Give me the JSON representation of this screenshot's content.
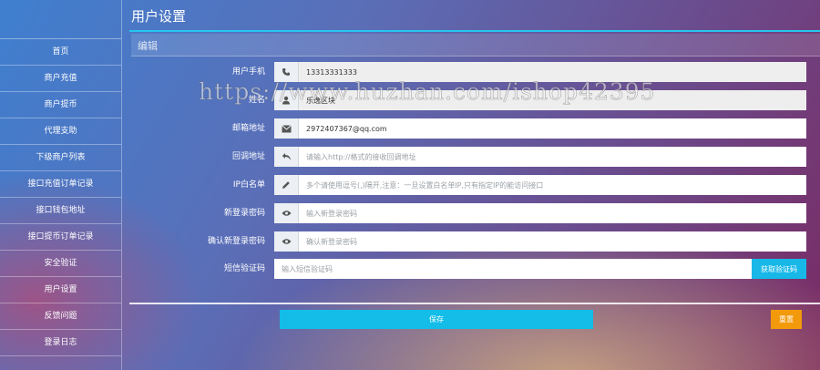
{
  "sidebar": {
    "items": [
      {
        "label": "首页"
      },
      {
        "label": "商户充值"
      },
      {
        "label": "商户提币"
      },
      {
        "label": "代理支助"
      },
      {
        "label": "下级商户列表"
      },
      {
        "label": "接口充值订单记录"
      },
      {
        "label": "接口钱包地址"
      },
      {
        "label": "接口提币订单记录"
      },
      {
        "label": "安全验证"
      },
      {
        "label": "用户设置"
      },
      {
        "label": "反馈问题"
      },
      {
        "label": "登录日志"
      }
    ]
  },
  "page": {
    "title": "用户设置",
    "section_title": "编辑"
  },
  "form": {
    "phone": {
      "label": "用户手机",
      "value": "13313331333",
      "icon": "phone-icon"
    },
    "name": {
      "label": "姓名",
      "value": "乐逸区块",
      "icon": "user-icon"
    },
    "email": {
      "label": "邮箱地址",
      "value": "2972407367@qq.com",
      "icon": "envelope-icon"
    },
    "callback": {
      "label": "回调地址",
      "value": "",
      "placeholder": "请输入http://格式的接收回调地址",
      "icon": "reply-icon"
    },
    "ip_whitelist": {
      "label": "IP白名单",
      "value": "",
      "placeholder": "多个请使用逗号(,)隔开,注意：一旦设置白名单IP,只有指定IP的能访问接口",
      "icon": "pencil-icon"
    },
    "new_password": {
      "label": "新登录密码",
      "value": "",
      "placeholder": "输入新登录密码",
      "icon": "eye-icon"
    },
    "confirm_password": {
      "label": "确认新登录密码",
      "value": "",
      "placeholder": "确认新登录密码",
      "icon": "eye-icon"
    },
    "sms_code": {
      "label": "短信验证码",
      "value": "",
      "placeholder": "输入短信验证码",
      "button_label": "获取验证码"
    }
  },
  "actions": {
    "save_label": "保存",
    "reset_label": "重置"
  },
  "watermark": "https://www.huzhan.com/ishop42395",
  "colors": {
    "accent": "#26c6f0",
    "save": "#13bde8",
    "reset": "#f29a0c",
    "sms_button": "#17b8e8"
  }
}
